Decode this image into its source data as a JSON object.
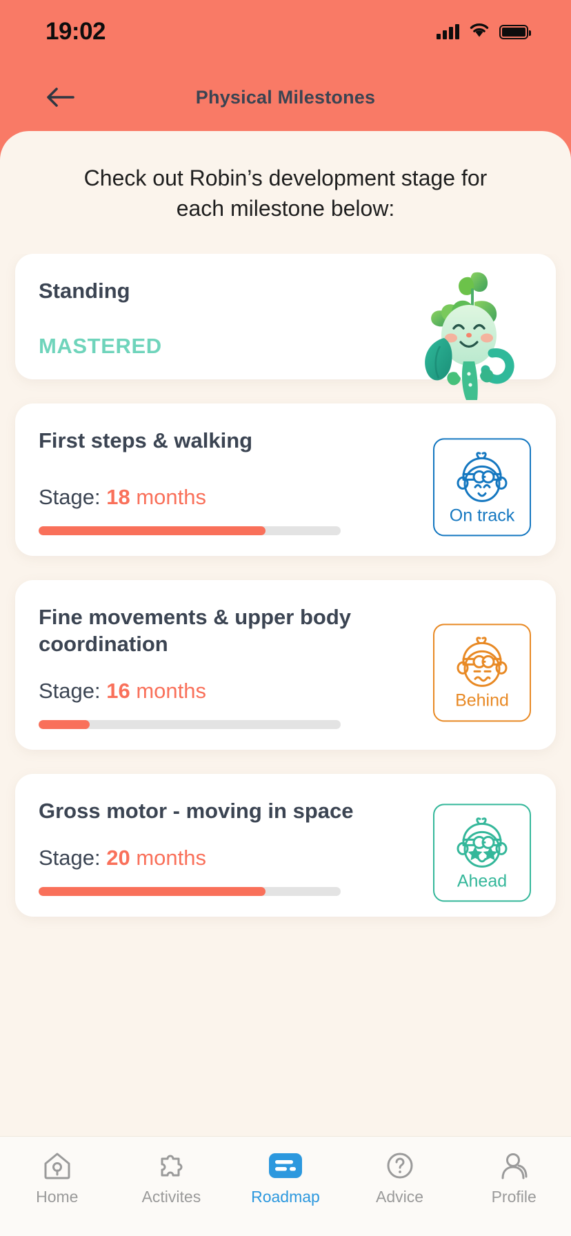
{
  "status_bar": {
    "time": "19:02",
    "signal_icon": "cellular-signal-icon",
    "wifi_icon": "wifi-icon",
    "battery_icon": "battery-full-icon"
  },
  "header": {
    "title": "Physical Milestones",
    "back_icon": "back-arrow-icon",
    "background_color": "#F97A66",
    "title_color": "#3B4452"
  },
  "intro": {
    "text": "Check out Robin’s development stage for each milestone below:"
  },
  "colors": {
    "coral": "#F9705A",
    "header_coral": "#F97A66",
    "sheet_bg": "#FBF4EC",
    "card_bg": "#FFFFFF",
    "title_slate": "#3B4452",
    "mastered_teal": "#6FD4BB",
    "ontrack_blue": "#1477C0",
    "behind_orange": "#E88924",
    "ahead_teal": "#34B79A",
    "track_gray": "#E3E3E3"
  },
  "milestones": [
    {
      "title": "Standing",
      "type": "mastered",
      "mastered_label": "MASTERED",
      "mascot_icon": "sprout-character-icon"
    },
    {
      "title": "First steps & walking",
      "type": "progress",
      "stage_prefix": "Stage:",
      "stage_value": "18",
      "stage_unit": "months",
      "progress_percent": 75,
      "badge": {
        "label": "On track",
        "color": "#1477C0",
        "icon": "baby-face-ontrack-icon"
      }
    },
    {
      "title": "Fine movements & upper body coordination",
      "type": "progress",
      "stage_prefix": "Stage:",
      "stage_value": "16",
      "stage_unit": "months",
      "progress_percent": 17,
      "badge": {
        "label": "Behind",
        "color": "#E88924",
        "icon": "baby-face-behind-icon"
      }
    },
    {
      "title": "Gross motor - moving in space",
      "type": "progress",
      "stage_prefix": "Stage:",
      "stage_value": "20",
      "stage_unit": "months",
      "progress_percent": 75,
      "badge": {
        "label": "Ahead",
        "color": "#34B79A",
        "icon": "baby-face-ahead-star-icon"
      }
    }
  ],
  "tabs": [
    {
      "label": "Home",
      "icon": "home-icon",
      "active": false
    },
    {
      "label": "Activites",
      "icon": "puzzle-icon",
      "active": false
    },
    {
      "label": "Roadmap",
      "icon": "roadmap-icon",
      "active": true
    },
    {
      "label": "Advice",
      "icon": "question-circle-icon",
      "active": false
    },
    {
      "label": "Profile",
      "icon": "person-icon",
      "active": false
    }
  ]
}
